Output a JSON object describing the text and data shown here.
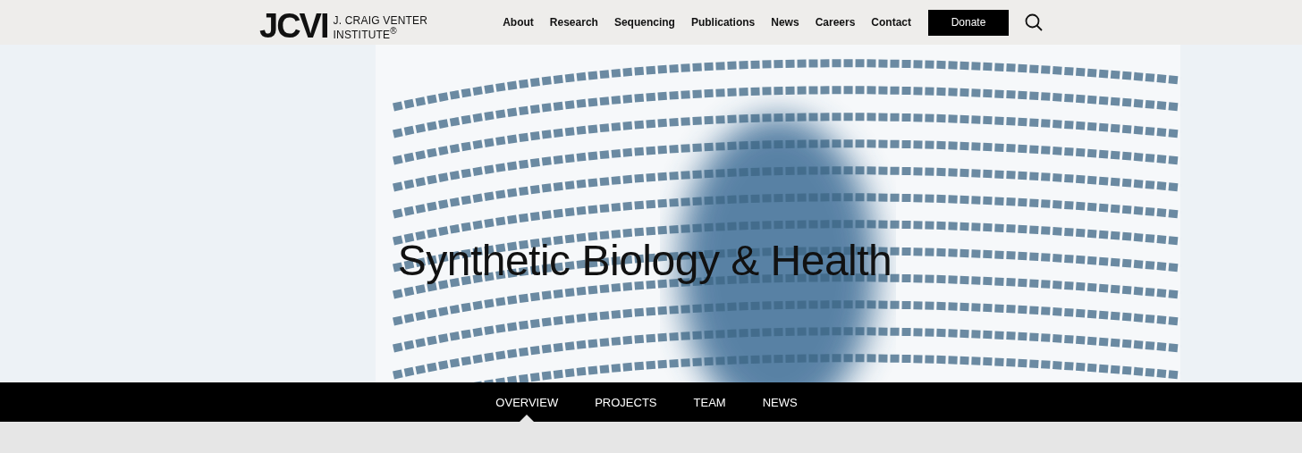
{
  "header": {
    "logo": {
      "mark": "JCVI",
      "name_line_1": "J. CRAIG VENTER",
      "name_line_2": "INSTITUTE$^{®}$"
    },
    "nav": [
      "About",
      "Research",
      "Sequencing",
      "Publications",
      "News",
      "Careers",
      "Contact"
    ],
    "donate_button": "Donate"
  },
  "hero": {
    "title": "Synthetic Biology & Health"
  },
  "tabs": [
    {
      "label": "OVERVIEW",
      "selected": true
    },
    {
      "label": "PROJECTS",
      "selected": false
    },
    {
      "label": "TEAM",
      "selected": false
    },
    {
      "label": "NEWS",
      "selected": false
    }
  ]
}
